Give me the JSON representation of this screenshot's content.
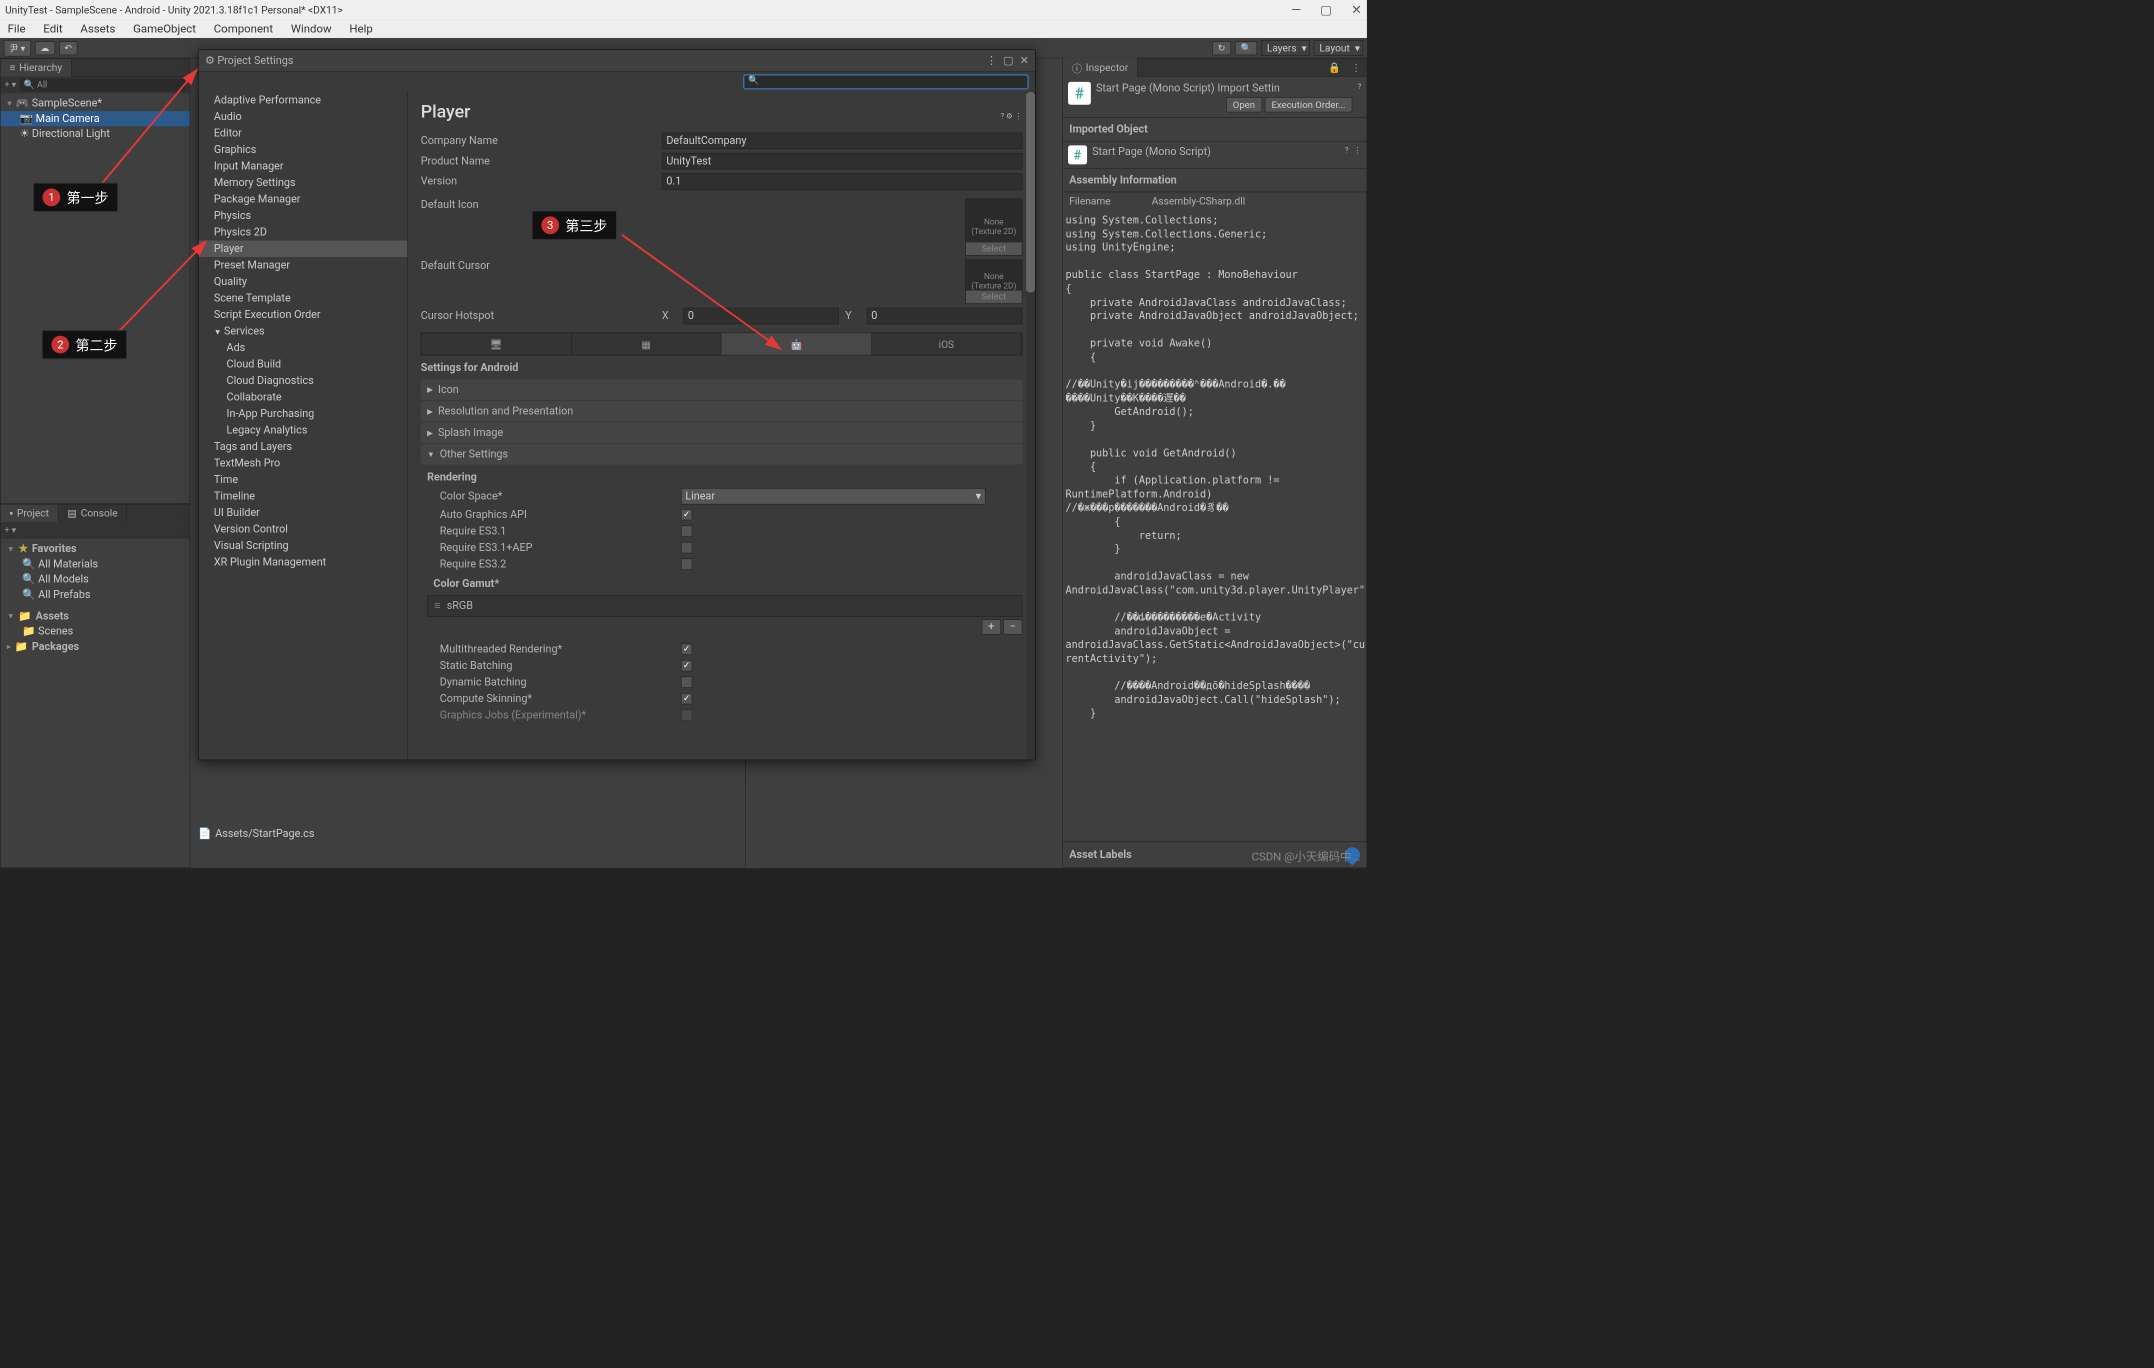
{
  "titlebar": {
    "text": "UnityTest - SampleScene - Android - Unity 2021.3.18f1c1 Personal* <DX11>"
  },
  "menu": [
    "File",
    "Edit",
    "Assets",
    "GameObject",
    "Component",
    "Window",
    "Help"
  ],
  "toolbar": {
    "account": "尹 ▾",
    "layers": "Layers",
    "layout": "Layout"
  },
  "hierarchy": {
    "title": "Hierarchy",
    "search_ph": "All",
    "scene": "SampleScene*",
    "items": [
      "Main Camera",
      "Directional Light"
    ]
  },
  "project": {
    "tabs": [
      "Project",
      "Console"
    ],
    "favorites": "Favorites",
    "fav_items": [
      "All Materials",
      "All Models",
      "All Prefabs"
    ],
    "assets": "Assets",
    "asset_items": [
      "Scenes"
    ],
    "packages": "Packages"
  },
  "inspector": {
    "title": "Inspector",
    "header": "Start Page (Mono Script) Import Settin",
    "open": "Open",
    "exec": "Execution Order...",
    "imported": "Imported Object",
    "obj_name": "Start Page (Mono Script)",
    "assembly_info": "Assembly Information",
    "filename_k": "Filename",
    "filename_v": "Assembly-CSharp.dll",
    "code": "using System.Collections;\nusing System.Collections.Generic;\nusing UnityEngine;\n\npublic class StartPage : MonoBehaviour\n{\n    private AndroidJavaClass androidJavaClass;\n    private AndroidJavaObject androidJavaObject;\n\n    private void Awake()\n    {\n\n//��Unity�ij���������ʱ���Android�.��\n����Unity��K����遅��\n        GetAndroid();\n    }\n\n    public void GetAndroid()\n    {\n        if (Application.platform != \nRuntimePlatform.Android)\n//�ж���p�������Android�豸��\n        {\n            return;\n        }\n\n        androidJavaClass = new \nAndroidJavaClass(\"com.unity3d.player.UnityPlayer\");\n\n        //��ȡ���������e�Activity\n        androidJavaObject = \nandroidJavaClass.GetStatic<AndroidJavaObject>(\"cur\nrentActivity\");\n\n        //����Android��дõ�hideSplash����\n        androidJavaObject.Call(\"hideSplash\");\n    }",
    "asset_labels": "Asset Labels"
  },
  "settings": {
    "title": "Project Settings",
    "sidebar": [
      "Adaptive Performance",
      "Audio",
      "Editor",
      "Graphics",
      "Input Manager",
      "Memory Settings",
      "Package Manager",
      "Physics",
      "Physics 2D",
      "Player",
      "Preset Manager",
      "Quality",
      "Scene Template",
      "Script Execution Order",
      "Services",
      "Ads",
      "Cloud Build",
      "Cloud Diagnostics",
      "Collaborate",
      "In-App Purchasing",
      "Legacy Analytics",
      "Tags and Layers",
      "TextMesh Pro",
      "Time",
      "Timeline",
      "UI Builder",
      "Version Control",
      "Visual Scripting",
      "XR Plugin Management"
    ],
    "content": {
      "heading": "Player",
      "company_k": "Company Name",
      "company_v": "DefaultCompany",
      "product_k": "Product Name",
      "product_v": "UnityTest",
      "version_k": "Version",
      "version_v": "0.1",
      "default_icon_k": "Default Icon",
      "none": "None",
      "texture2d": "(Texture 2D)",
      "select": "Select",
      "default_cursor_k": "Default Cursor",
      "cursor_hotspot_k": "Cursor Hotspot",
      "x": "X",
      "x_v": "0",
      "y": "Y",
      "y_v": "0",
      "ios": "iOS",
      "settings_android": "Settings for Android",
      "icon": "Icon",
      "res_pres": "Resolution and Presentation",
      "splash": "Splash Image",
      "other": "Other Settings",
      "rendering": "Rendering",
      "color_space_k": "Color Space*",
      "color_space_v": "Linear",
      "auto_gfx": "Auto Graphics API",
      "req31": "Require ES3.1",
      "req31aep": "Require ES3.1+AEP",
      "req32": "Require ES3.2",
      "gamut": "Color Gamut*",
      "srgb": "sRGB",
      "multi": "Multithreaded Rendering*",
      "static_b": "Static Batching",
      "dynamic_b": "Dynamic Batching",
      "compute_skin": "Compute Skinning*",
      "gfx_jobs": "Graphics Jobs (Experimental)*"
    }
  },
  "annotations": {
    "step1": "第一步",
    "step2": "第二步",
    "step3": "第三步"
  },
  "footer": {
    "path": "Assets/StartPage.cs",
    "watermark": "CSDN @小天编码中..."
  }
}
